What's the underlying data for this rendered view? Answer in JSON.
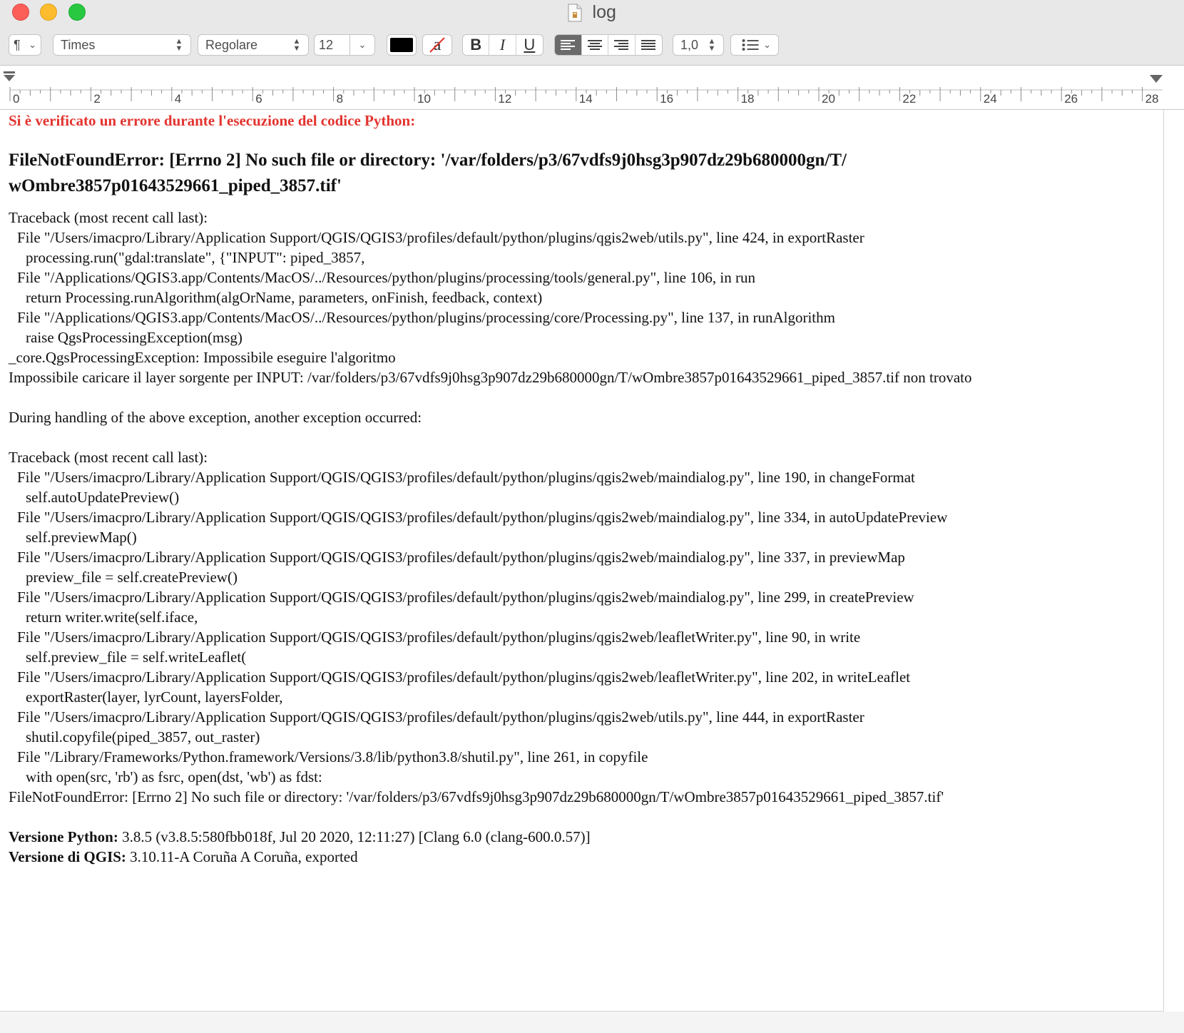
{
  "window": {
    "title": "log"
  },
  "toolbar": {
    "paragraph_style": "¶",
    "font_family": "Times",
    "font_style": "Regolare",
    "font_size": "12",
    "text_color": "#000000",
    "highlight_glyph": "a",
    "bold": "B",
    "italic": "I",
    "underline": "U",
    "line_spacing": "1,0"
  },
  "ruler": {
    "labels": [
      "0",
      "2",
      "4",
      "6",
      "8",
      "10",
      "12",
      "14",
      "16",
      "18",
      "20",
      "22",
      "24",
      "26",
      "28"
    ]
  },
  "document": {
    "error_heading": "Si è verificato un errore durante l'esecuzione del codice Python:",
    "summary_line1": "FileNotFoundError: [Errno 2] No such file or directory: '/var/folders/p3/67vdfs9j0hsg3p907dz29b680000gn/T/",
    "summary_line2": "wOmbre3857p01643529661_piped_3857.tif'",
    "traceback1": [
      {
        "text": "Traceback (most recent call last):",
        "indent": 0
      },
      {
        "text": "File \"/Users/imacpro/Library/Application Support/QGIS/QGIS3/profiles/default/python/plugins/qgis2web/utils.py\", line 424, in exportRaster",
        "indent": 1
      },
      {
        "text": "processing.run(\"gdal:translate\", {\"INPUT\": piped_3857,",
        "indent": 2
      },
      {
        "text": "File \"/Applications/QGIS3.app/Contents/MacOS/../Resources/python/plugins/processing/tools/general.py\", line 106, in run",
        "indent": 1
      },
      {
        "text": "return Processing.runAlgorithm(algOrName, parameters, onFinish, feedback, context)",
        "indent": 2
      },
      {
        "text": "File \"/Applications/QGIS3.app/Contents/MacOS/../Resources/python/plugins/processing/core/Processing.py\", line 137, in runAlgorithm",
        "indent": 1
      },
      {
        "text": "raise QgsProcessingException(msg)",
        "indent": 2
      },
      {
        "text": "_core.QgsProcessingException: Impossibile eseguire l'algoritmo",
        "indent": 0
      },
      {
        "text": "Impossibile caricare il layer sorgente per INPUT: /var/folders/p3/67vdfs9j0hsg3p907dz29b680000gn/T/wOmbre3857p01643529661_piped_3857.tif non trovato",
        "indent": 0
      }
    ],
    "during_handling": "During handling of the above exception, another exception occurred:",
    "traceback2": [
      {
        "text": "Traceback (most recent call last):",
        "indent": 0
      },
      {
        "text": "File \"/Users/imacpro/Library/Application Support/QGIS/QGIS3/profiles/default/python/plugins/qgis2web/maindialog.py\", line 190, in changeFormat",
        "indent": 1
      },
      {
        "text": "self.autoUpdatePreview()",
        "indent": 2
      },
      {
        "text": "File \"/Users/imacpro/Library/Application Support/QGIS/QGIS3/profiles/default/python/plugins/qgis2web/maindialog.py\", line 334, in autoUpdatePreview",
        "indent": 1
      },
      {
        "text": "self.previewMap()",
        "indent": 2
      },
      {
        "text": "File \"/Users/imacpro/Library/Application Support/QGIS/QGIS3/profiles/default/python/plugins/qgis2web/maindialog.py\", line 337, in previewMap",
        "indent": 1
      },
      {
        "text": "preview_file = self.createPreview()",
        "indent": 2
      },
      {
        "text": "File \"/Users/imacpro/Library/Application Support/QGIS/QGIS3/profiles/default/python/plugins/qgis2web/maindialog.py\", line 299, in createPreview",
        "indent": 1
      },
      {
        "text": "return writer.write(self.iface,",
        "indent": 2
      },
      {
        "text": "File \"/Users/imacpro/Library/Application Support/QGIS/QGIS3/profiles/default/python/plugins/qgis2web/leafletWriter.py\", line 90, in write",
        "indent": 1
      },
      {
        "text": "self.preview_file = self.writeLeaflet(",
        "indent": 2
      },
      {
        "text": "File \"/Users/imacpro/Library/Application Support/QGIS/QGIS3/profiles/default/python/plugins/qgis2web/leafletWriter.py\", line 202, in writeLeaflet",
        "indent": 1
      },
      {
        "text": "exportRaster(layer, lyrCount, layersFolder,",
        "indent": 2
      },
      {
        "text": "File \"/Users/imacpro/Library/Application Support/QGIS/QGIS3/profiles/default/python/plugins/qgis2web/utils.py\", line 444, in exportRaster",
        "indent": 1
      },
      {
        "text": "shutil.copyfile(piped_3857, out_raster)",
        "indent": 2
      },
      {
        "text": "File \"/Library/Frameworks/Python.framework/Versions/3.8/lib/python3.8/shutil.py\", line 261, in copyfile",
        "indent": 1
      },
      {
        "text": "with open(src, 'rb') as fsrc, open(dst, 'wb') as fdst:",
        "indent": 2
      },
      {
        "text": "FileNotFoundError: [Errno 2] No such file or directory: '/var/folders/p3/67vdfs9j0hsg3p907dz29b680000gn/T/wOmbre3857p01643529661_piped_3857.tif'",
        "indent": 0
      }
    ],
    "python_version_label": "Versione Python:",
    "python_version_value": "3.8.5 (v3.8.5:580fbb018f, Jul 20 2020, 12:11:27) [Clang 6.0 (clang-600.0.57)]",
    "qgis_version_label": "Versione di QGIS:",
    "qgis_version_value": "3.10.11-A Coruña A Coruña, exported"
  },
  "colors": {
    "error_red": "#e3342f",
    "chrome_gray": "#e8e8e8",
    "active_segment": "#6a6a6a"
  }
}
